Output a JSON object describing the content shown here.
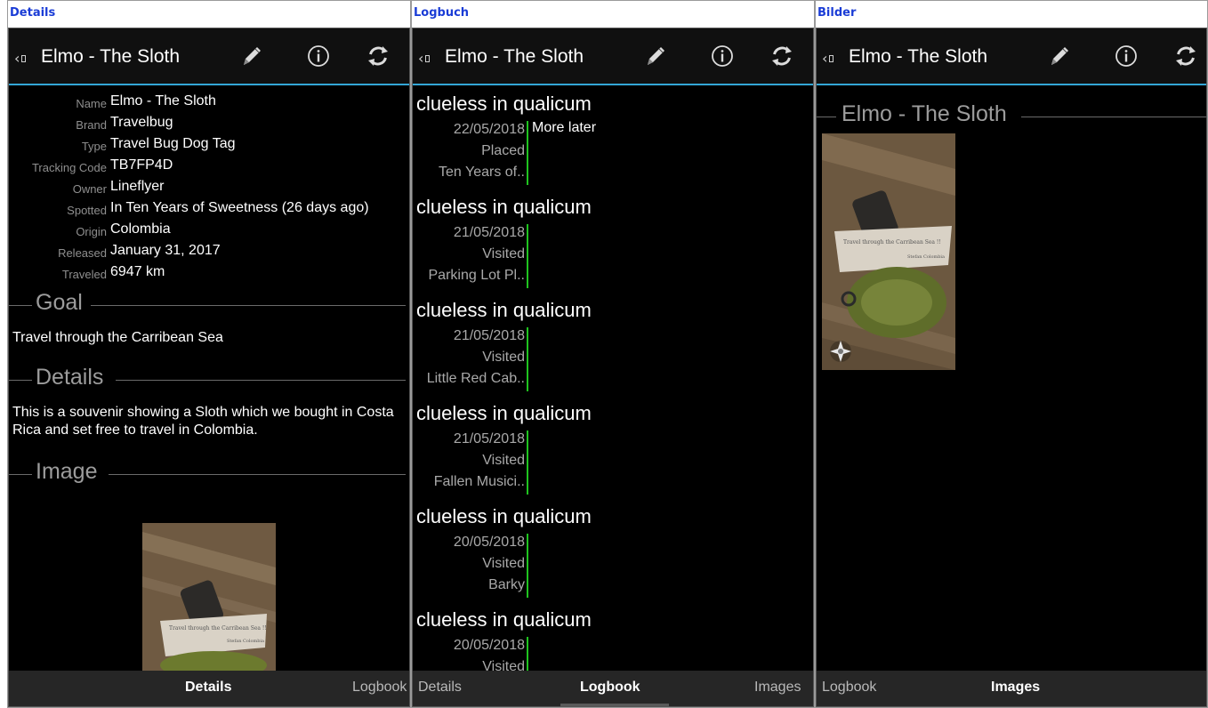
{
  "panels": {
    "details": {
      "heading": "Details"
    },
    "logbuch": {
      "heading": "Logbuch"
    },
    "bilder": {
      "heading": "Bilder"
    }
  },
  "app": {
    "title": "Elmo - The Sloth",
    "accent": "#33a6d6",
    "log_bar_color": "#1fc31f",
    "icons": [
      "back-icon",
      "pencil-icon",
      "info-icon",
      "refresh-icon"
    ]
  },
  "details": {
    "fields": [
      {
        "label": "Name",
        "value": "Elmo - The Sloth"
      },
      {
        "label": "Brand",
        "value": "Travelbug"
      },
      {
        "label": "Type",
        "value": "Travel Bug Dog Tag"
      },
      {
        "label": "Tracking Code",
        "value": "TB7FP4D"
      },
      {
        "label": "Owner",
        "value": "Lineflyer"
      },
      {
        "label": "Spotted",
        "value": "In Ten Years of Sweetness (26 days ago)"
      },
      {
        "label": "Origin",
        "value": "Colombia"
      },
      {
        "label": "Released",
        "value": "January 31, 2017"
      },
      {
        "label": "Traveled",
        "value": "6947 km"
      }
    ],
    "goal_heading": "Goal",
    "goal_text": "Travel through the Carribean Sea",
    "details_heading": "Details",
    "details_text": "This is a souvenir showing a Sloth which we bought in Costa Rica and set free to travel in Colombia.",
    "image_heading": "Image",
    "photo_note": "Travel through the Carribean Sea !!",
    "photo_sign": "Stefan Colombia"
  },
  "logbook": {
    "entries": [
      {
        "name": "clueless in qualicum",
        "date": "22/05/2018",
        "type": "Placed",
        "cache": "Ten Years of..",
        "text": "More later"
      },
      {
        "name": "clueless in qualicum",
        "date": "21/05/2018",
        "type": "Visited",
        "cache": "Parking Lot Pl..",
        "text": ""
      },
      {
        "name": "clueless in qualicum",
        "date": "21/05/2018",
        "type": "Visited",
        "cache": "Little Red Cab..",
        "text": ""
      },
      {
        "name": "clueless in qualicum",
        "date": "21/05/2018",
        "type": "Visited",
        "cache": "Fallen Musici..",
        "text": ""
      },
      {
        "name": "clueless in qualicum",
        "date": "20/05/2018",
        "type": "Visited",
        "cache": "Barky",
        "text": ""
      },
      {
        "name": "clueless in qualicum",
        "date": "20/05/2018",
        "type": "Visited",
        "cache": "",
        "text": ""
      }
    ]
  },
  "images": {
    "heading": "Elmo - The Sloth"
  },
  "tabs": {
    "details": "Details",
    "logbook": "Logbook",
    "images": "Images"
  }
}
